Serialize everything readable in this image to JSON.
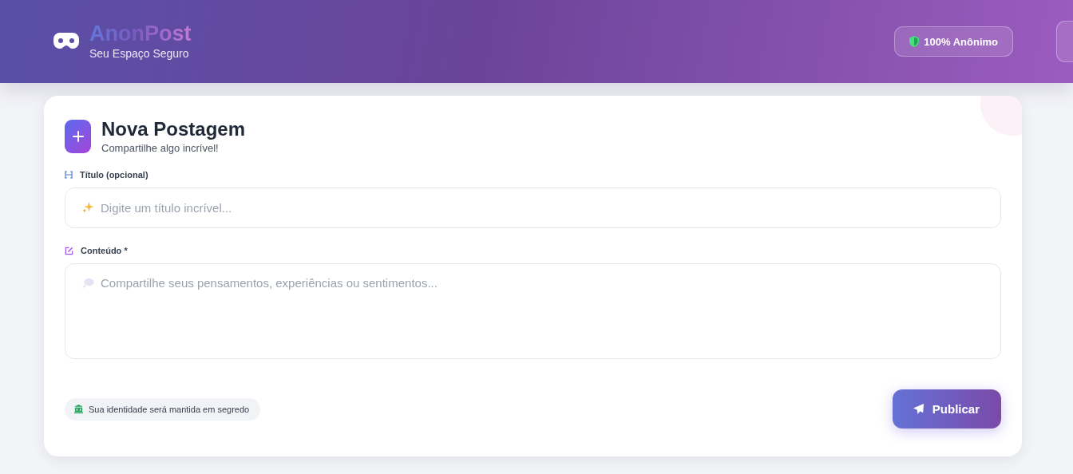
{
  "header": {
    "brand": "AnonPost",
    "tagline": "Seu Espaço Seguro",
    "badge": "100% Anônimo"
  },
  "form": {
    "title": "Nova Postagem",
    "subtitle": "Compartilhe algo incrível!",
    "fields": [
      {
        "kind": "input",
        "label": "Título (opcional)",
        "placeholder": "Digite um título incrível..."
      },
      {
        "kind": "textarea",
        "label": "Conteúdo *",
        "placeholder": "Compartilhe seus pensamentos, experiências ou sentimentos..."
      }
    ],
    "notice": "Sua identidade será mantida em segredo",
    "submit": "Publicar"
  }
}
